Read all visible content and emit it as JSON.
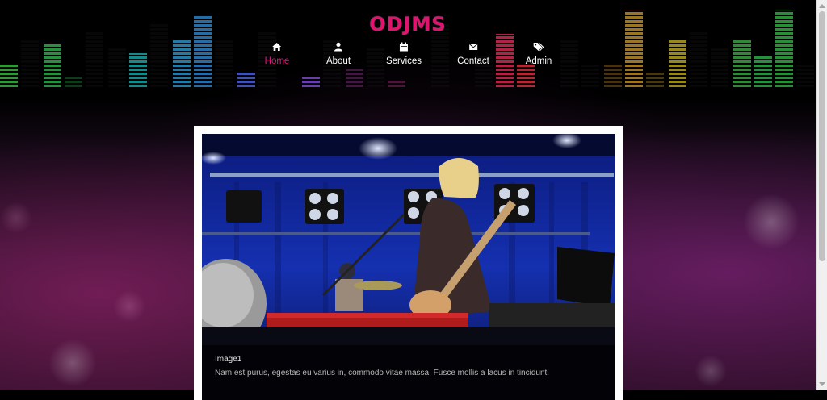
{
  "site": {
    "logo": "ODJMS",
    "brand_color": "#e0136f"
  },
  "nav": {
    "items": [
      {
        "label": "Home",
        "icon": "home-icon",
        "active": true
      },
      {
        "label": "About",
        "icon": "user-icon",
        "active": false
      },
      {
        "label": "Services",
        "icon": "calendar-icon",
        "active": false
      },
      {
        "label": "Contact",
        "icon": "envelope-icon",
        "active": false
      },
      {
        "label": "Admin",
        "icon": "tags-icon",
        "active": false
      }
    ]
  },
  "slide": {
    "title": "Image1",
    "description": "Nam est purus, egestas eu varius in, commodo vitae massa. Fusce mollis a lacus in tincidunt."
  }
}
